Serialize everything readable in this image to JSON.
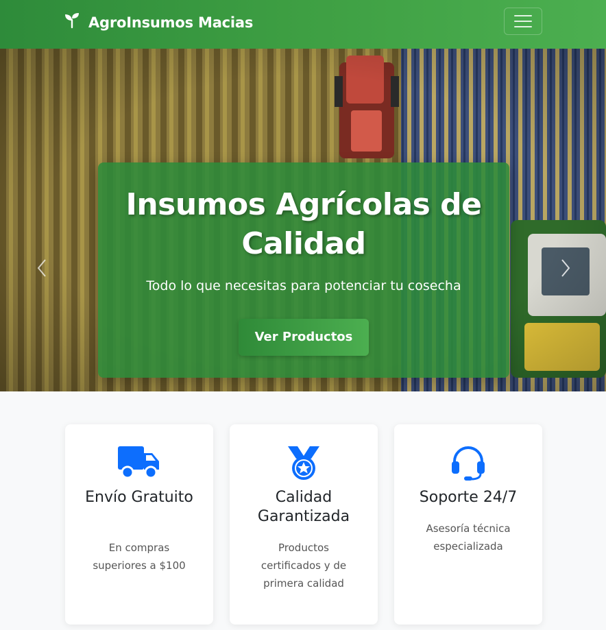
{
  "navbar": {
    "brand": "AgroInsumos Macias",
    "brand_icon": "seedling-icon",
    "toggler_icon": "hamburger-icon"
  },
  "hero": {
    "title": "Insumos Agrícolas de Calidad",
    "subtitle": "Todo lo que necesitas para potenciar tu cosecha",
    "cta_label": "Ver Productos",
    "prev_icon": "chevron-left-icon",
    "next_icon": "chevron-right-icon"
  },
  "features": [
    {
      "icon": "truck-icon",
      "title": "Envío Gratuito",
      "description": "En compras superiores a $100"
    },
    {
      "icon": "medal-icon",
      "title": "Calidad Garantizada",
      "description": "Productos certificados y de primera calidad"
    },
    {
      "icon": "headset-icon",
      "title": "Soporte 24/7",
      "description": "Asesoría técnica especializada"
    }
  ],
  "colors": {
    "brand_green": "#2e8b3a",
    "accent_green": "#4caf50",
    "icon_blue": "#0d6efd"
  }
}
